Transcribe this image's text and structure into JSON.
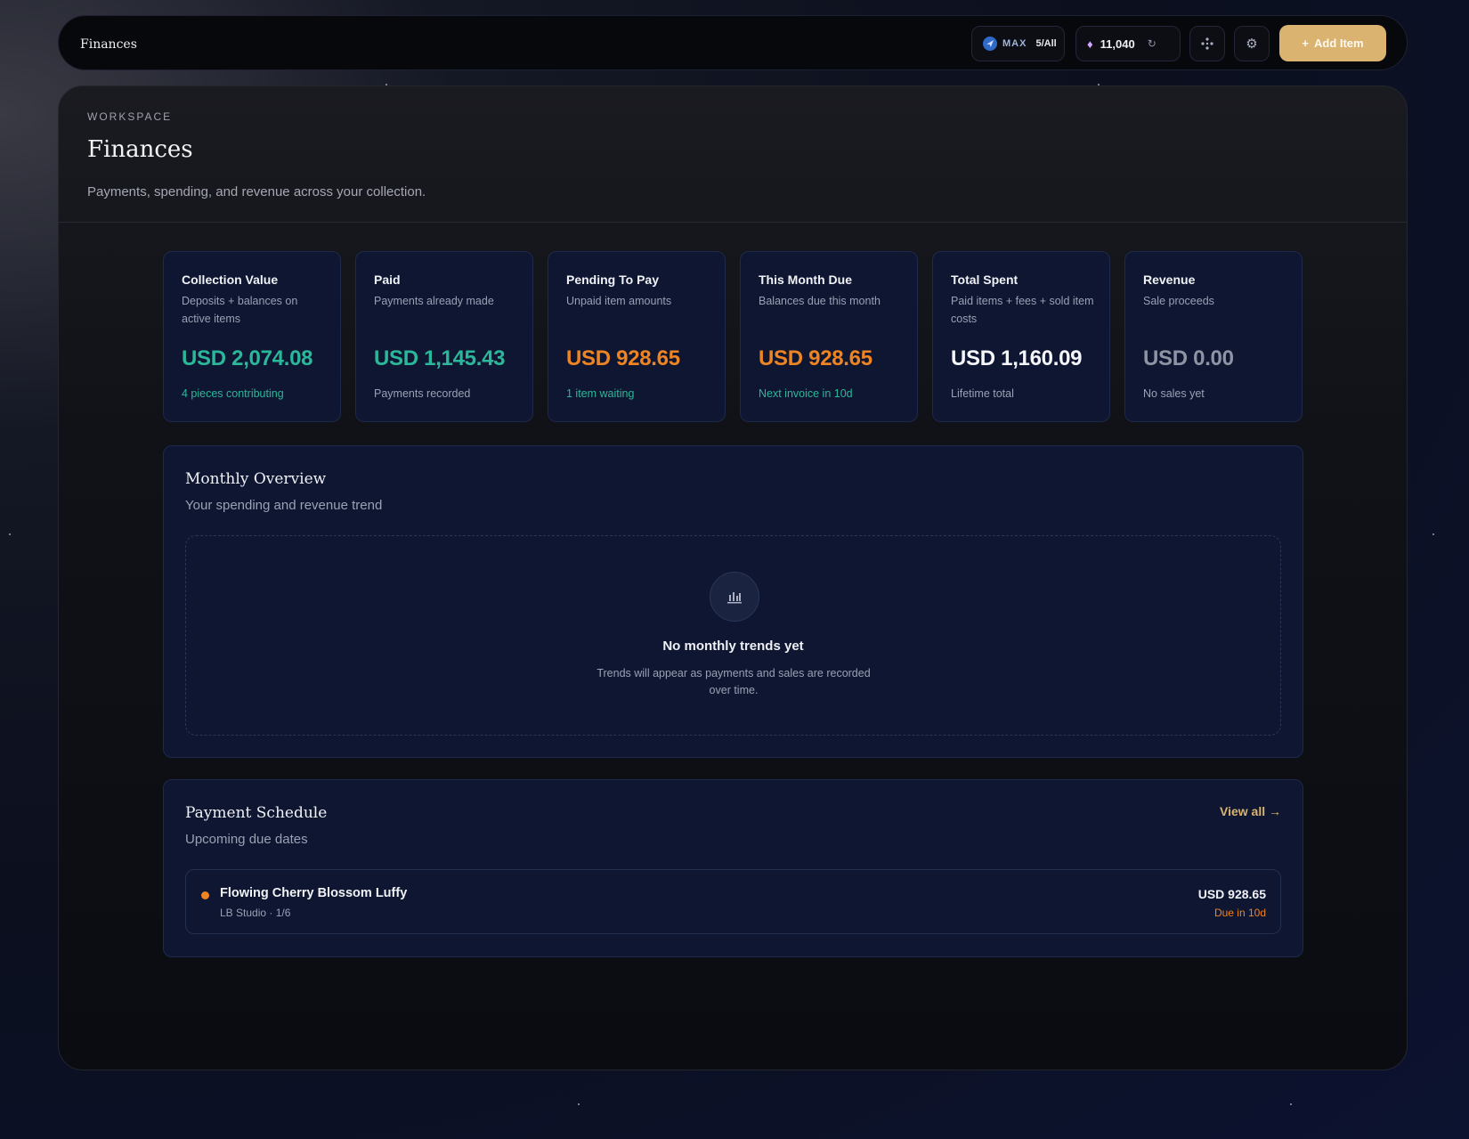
{
  "topbar": {
    "title": "Finances",
    "plan": {
      "name": "MAX",
      "count": "5/All"
    },
    "credits": "11,040",
    "add_label": "Add Item"
  },
  "header": {
    "eyebrow": "WORKSPACE",
    "title": "Finances",
    "subtitle": "Payments, spending, and revenue across your collection."
  },
  "cards": [
    {
      "title": "Collection Value",
      "desc": "Deposits + balances on active items",
      "value": "USD 2,074.08",
      "foot": "4 pieces contributing",
      "value_color": "#2bb89a",
      "foot_color": "#2bb89a"
    },
    {
      "title": "Paid",
      "desc": "Payments already made",
      "value": "USD 1,145.43",
      "foot": "Payments recorded",
      "value_color": "#2bb89a",
      "foot_color": "#9aa1b4"
    },
    {
      "title": "Pending To Pay",
      "desc": "Unpaid item amounts",
      "value": "USD 928.65",
      "foot": "1 item waiting",
      "value_color": "#ee8422",
      "foot_color": "#2bb89a"
    },
    {
      "title": "This Month Due",
      "desc": "Balances due this month",
      "value": "USD 928.65",
      "foot": "Next invoice in 10d",
      "value_color": "#ee8422",
      "foot_color": "#2bb89a"
    },
    {
      "title": "Total Spent",
      "desc": "Paid items + fees + sold item costs",
      "value": "USD 1,160.09",
      "foot": "Lifetime total",
      "value_color": "#f5f6fa",
      "foot_color": "#9aa1b4"
    },
    {
      "title": "Revenue",
      "desc": "Sale proceeds",
      "value": "USD 0.00",
      "foot": "No sales yet",
      "value_color": "#8f94a4",
      "foot_color": "#9aa1b4"
    }
  ],
  "overview": {
    "title": "Monthly Overview",
    "subtitle": "Your spending and revenue trend",
    "empty_title": "No monthly trends yet",
    "empty_text": "Trends will appear as payments and sales are recorded over time."
  },
  "schedule": {
    "title": "Payment Schedule",
    "subtitle": "Upcoming due dates",
    "view_all": "View all →",
    "items": [
      {
        "name": "Flowing Cherry Blossom Luffy",
        "meta": "LB Studio · 1/6",
        "amount": "USD 928.65",
        "due": "Due in 10d"
      }
    ]
  },
  "icons": {
    "plan": "telegram-plane-icon",
    "credits": "gem-icon",
    "refresh": "refresh-icon",
    "nodes": "nodes-icon",
    "settings": "gear-icon",
    "chart": "bar-chart-icon"
  },
  "colors": {
    "accent_gold": "#d9b36f",
    "positive": "#2bb89a",
    "warning": "#ee8422",
    "card_bg": "#0e1631"
  }
}
